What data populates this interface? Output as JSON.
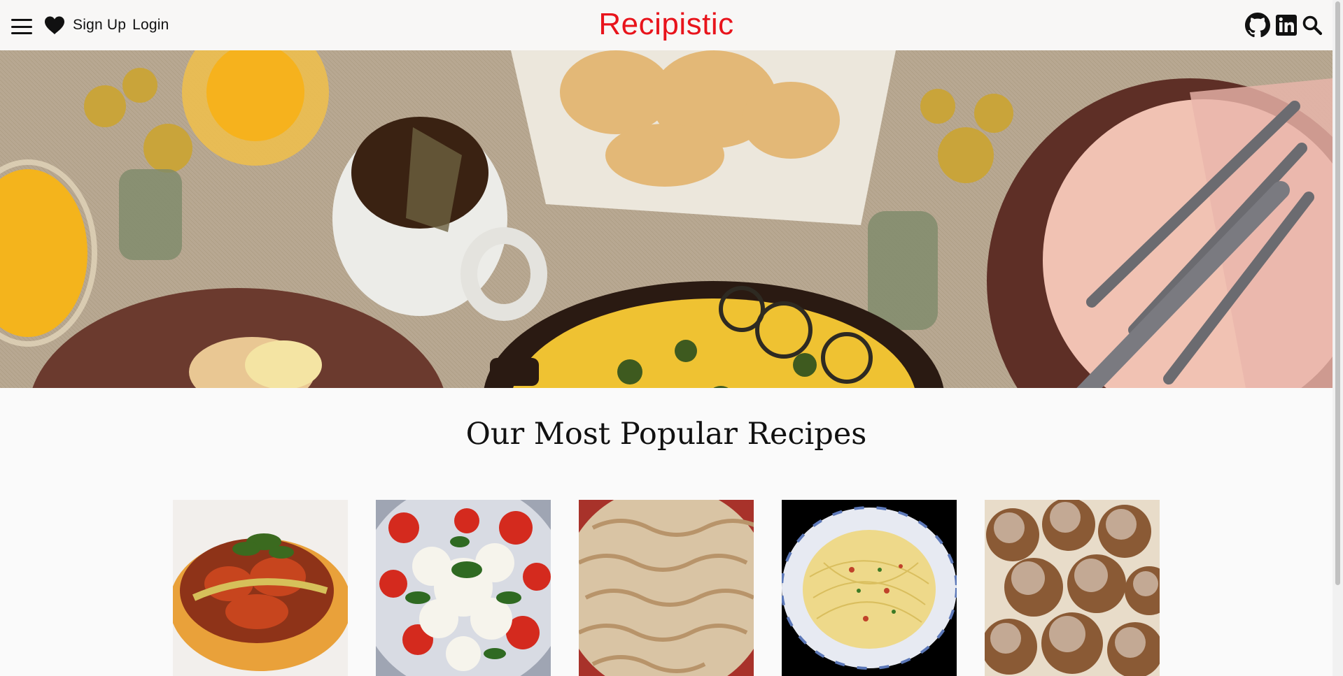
{
  "nav": {
    "menu_icon": "hamburger-menu-icon",
    "favorites_icon": "heart-icon",
    "signup_label": "Sign Up",
    "login_label": "Login",
    "brand": "Recipistic",
    "brand_color": "#e8141c",
    "right_icons": [
      "github-icon",
      "linkedin-icon",
      "search-icon"
    ]
  },
  "hero": {
    "image": "breakfast table with frittata, tea, biscuits and flowers"
  },
  "popular": {
    "title": "Our Most Popular Recipes",
    "cards": [
      {
        "image": "ratatouille"
      },
      {
        "image": "caprese salad"
      },
      {
        "image": "lattice pie"
      },
      {
        "image": "spaghetti aglio e olio"
      },
      {
        "image": "sugared doughnut holes"
      }
    ]
  }
}
